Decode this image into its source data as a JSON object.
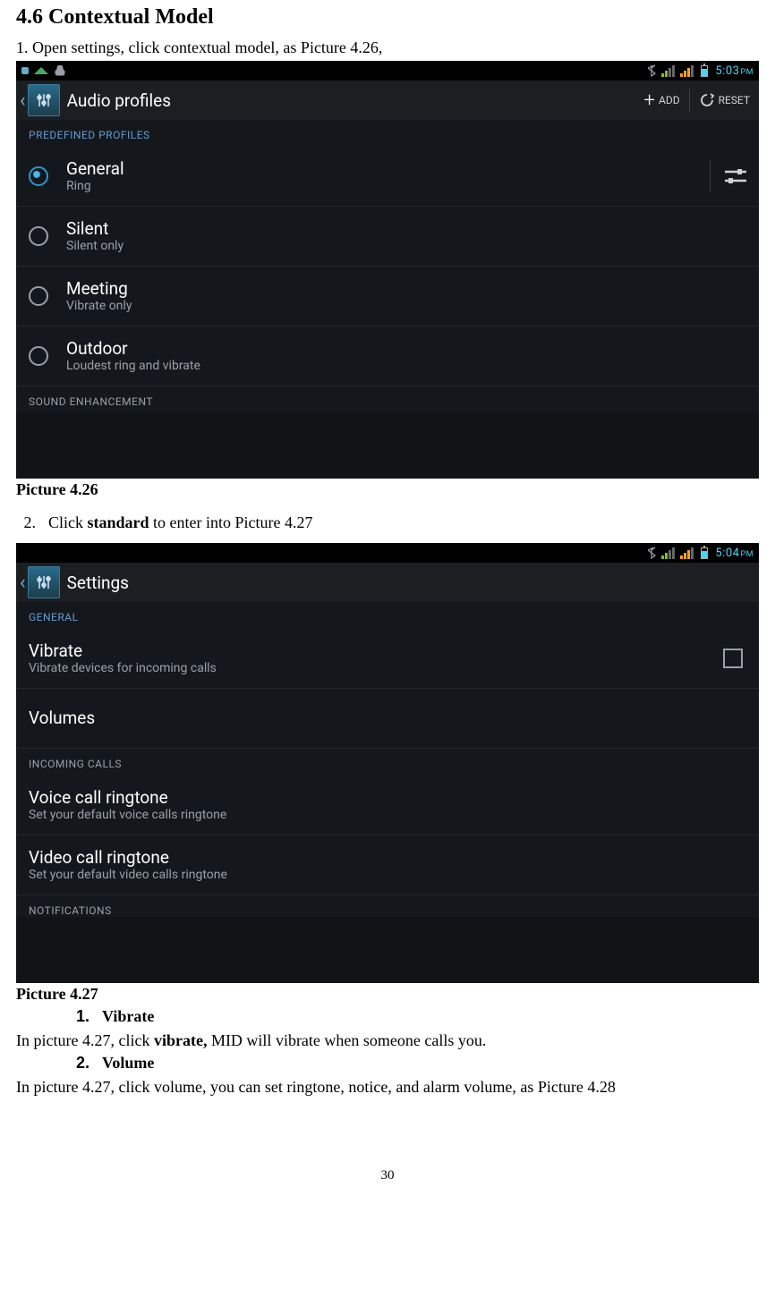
{
  "doc": {
    "heading": "4.6 Contextual Model",
    "step1": "1. Open settings, click contextual model, as Picture 4.26,",
    "caption1": "Picture 4.26",
    "step2_num": "2.",
    "step2_prefix": "Click ",
    "step2_bold": "standard",
    "step2_suffix": " to enter into Picture 4.27",
    "caption2": "Picture 4.27",
    "sub1_num": "1.",
    "sub1_text": "Vibrate",
    "sub1_body_a": "In picture 4.27, click ",
    "sub1_body_b": "vibrate,",
    "sub1_body_c": " MID will vibrate when someone calls you.",
    "sub2_num": "2.",
    "sub2_text": "Volume",
    "sub2_body": "In picture 4.27, click volume, you can set ringtone, notice, and alarm volume, as Picture 4.28",
    "page_number": "30"
  },
  "shot1": {
    "status_time": "5:03",
    "status_period": "PM",
    "hdr_title": "Audio profiles",
    "add_label": "ADD",
    "reset_label": "RESET",
    "section_predef": "PREDEFINED PROFILES",
    "rows": [
      {
        "title": "General",
        "sub": "Ring"
      },
      {
        "title": "Silent",
        "sub": "Silent only"
      },
      {
        "title": "Meeting",
        "sub": "Vibrate only"
      },
      {
        "title": "Outdoor",
        "sub": "Loudest ring and vibrate"
      }
    ],
    "section_sound": "SOUND ENHANCEMENT"
  },
  "shot2": {
    "status_time": "5:04",
    "status_period": "PM",
    "hdr_title": "Settings",
    "section_general": "GENERAL",
    "row_vibrate_title": "Vibrate",
    "row_vibrate_sub": "Vibrate devices for incoming calls",
    "row_volumes_title": "Volumes",
    "section_incoming": "INCOMING CALLS",
    "row_voice_title": "Voice call ringtone",
    "row_voice_sub": "Set your default voice calls ringtone",
    "row_video_title": "Video call ringtone",
    "row_video_sub": "Set your default video calls ringtone",
    "section_notif": "NOTIFICATIONS"
  }
}
